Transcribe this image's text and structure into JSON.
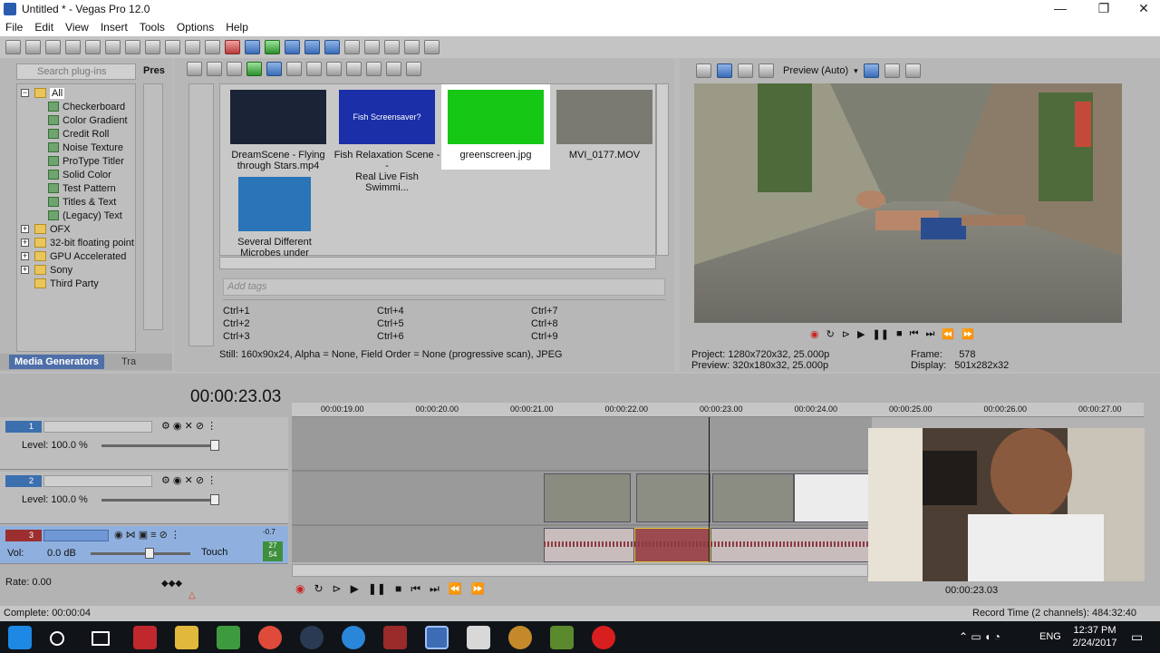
{
  "window": {
    "title": "Untitled * - Vegas Pro 12.0",
    "controls": [
      "—",
      "❐",
      "✕"
    ]
  },
  "menu": [
    "File",
    "Edit",
    "View",
    "Insert",
    "Tools",
    "Options",
    "Help"
  ],
  "plugins": {
    "search_placeholder": "Search plug-ins",
    "pres_label": "Pres",
    "tree": [
      {
        "label": "All",
        "level": 0,
        "type": "folder",
        "selected": true
      },
      {
        "label": "Checkerboard",
        "level": 1,
        "type": "gen"
      },
      {
        "label": "Color Gradient",
        "level": 1,
        "type": "gen"
      },
      {
        "label": "Credit Roll",
        "level": 1,
        "type": "gen"
      },
      {
        "label": "Noise Texture",
        "level": 1,
        "type": "gen"
      },
      {
        "label": "ProType Titler",
        "level": 1,
        "type": "gen"
      },
      {
        "label": "Solid Color",
        "level": 1,
        "type": "gen"
      },
      {
        "label": "Test Pattern",
        "level": 1,
        "type": "gen"
      },
      {
        "label": "Titles & Text",
        "level": 1,
        "type": "gen"
      },
      {
        "label": "(Legacy) Text",
        "level": 1,
        "type": "gen"
      },
      {
        "label": "OFX",
        "level": 0,
        "type": "folder",
        "expand": true
      },
      {
        "label": "32-bit floating point",
        "level": 0,
        "type": "folder",
        "expand": true
      },
      {
        "label": "GPU Accelerated",
        "level": 0,
        "type": "folder",
        "expand": true
      },
      {
        "label": "Sony",
        "level": 0,
        "type": "folder",
        "expand": true
      },
      {
        "label": "Third Party",
        "level": 0,
        "type": "folder",
        "expand": false
      }
    ],
    "tab_active": "Media Generators",
    "tab_other": "Tra"
  },
  "media": {
    "items": [
      {
        "label": "DreamScene - Flying through Stars.mp4",
        "line1": "DreamScene - Flying",
        "line2": "through Stars.mp4",
        "color": "#1b2436",
        "selected": false
      },
      {
        "label": "Fish Relaxation Scene -- Real Live Fish Swimmi...",
        "line1": "Fish Relaxation Scene --",
        "line2": "Real Live Fish Swimmi...",
        "color": "#1a2fa8",
        "overlay": "Fish Screensaver?",
        "selected": false
      },
      {
        "label": "greenscreen.jpg",
        "line1": "greenscreen.jpg",
        "line2": "",
        "color": "#16c716",
        "selected": true
      },
      {
        "label": "MVI_0177.MOV",
        "line1": "MVI_0177.MOV",
        "line2": "",
        "color": "#7a7a72",
        "selected": false
      },
      {
        "label": "Several Different Microbes under micros...",
        "line1": "Several Different",
        "line2": "Microbes under micros...",
        "color": "#2a74b8",
        "selected": false
      }
    ],
    "tags_placeholder": "Add tags",
    "shortcuts": [
      "Ctrl+1",
      "Ctrl+4",
      "Ctrl+7",
      "Ctrl+2",
      "Ctrl+5",
      "Ctrl+8",
      "Ctrl+3",
      "Ctrl+6",
      "Ctrl+9"
    ],
    "info": "Still: 160x90x24, Alpha = None, Field Order = None (progressive scan), JPEG"
  },
  "preview": {
    "mode": "Preview (Auto)",
    "project_label": "Project:",
    "project_value": "1280x720x32, 25.000p",
    "preview_label": "Preview:",
    "preview_value": "320x180x32, 25.000p",
    "frame_label": "Frame:",
    "frame_value": "578",
    "display_label": "Display:",
    "display_value": "501x282x32"
  },
  "timeline": {
    "timecode": "00:00:23.03",
    "ruler": [
      "00:00:19.00",
      "00:00:20.00",
      "00:00:21.00",
      "00:00:22.00",
      "00:00:23.00",
      "00:00:24.00",
      "00:00:25.00",
      "00:00:26.00",
      "00:00:27.00"
    ],
    "tracks": [
      {
        "num": "1",
        "level": "Level: 100.0 %"
      },
      {
        "num": "2",
        "level": "Level: 100.0 %"
      }
    ],
    "audio": {
      "num": "3",
      "vol": "Vol:",
      "vol_value": "0.0 dB",
      "touch": "Touch",
      "meter_top": "-0.7",
      "meter_a": "27",
      "meter_b": "54"
    },
    "rate": "Rate: 0.00",
    "bottom_timecode": "00:00:23.03"
  },
  "status": {
    "complete": "Complete: 00:00:04",
    "record_time": "Record Time (2 channels): 484:32:40"
  },
  "taskbar": {
    "lang": "ENG",
    "time": "12:37 PM",
    "date": "2/24/2017"
  }
}
